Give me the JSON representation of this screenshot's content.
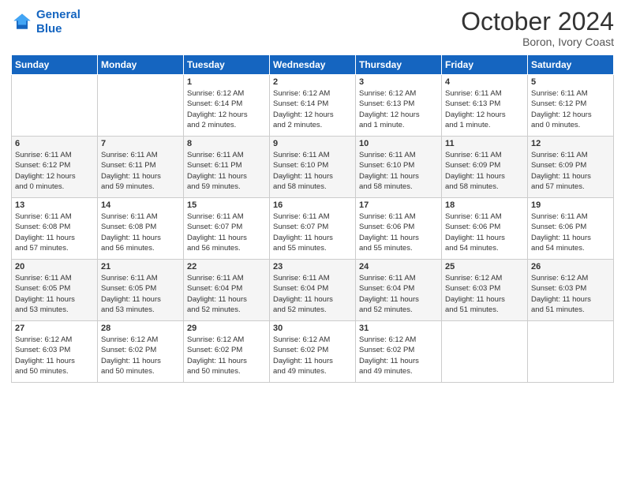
{
  "header": {
    "logo_line1": "General",
    "logo_line2": "Blue",
    "month_year": "October 2024",
    "location": "Boron, Ivory Coast"
  },
  "days_of_week": [
    "Sunday",
    "Monday",
    "Tuesday",
    "Wednesday",
    "Thursday",
    "Friday",
    "Saturday"
  ],
  "weeks": [
    [
      {
        "day": "",
        "info": ""
      },
      {
        "day": "",
        "info": ""
      },
      {
        "day": "1",
        "info": "Sunrise: 6:12 AM\nSunset: 6:14 PM\nDaylight: 12 hours\nand 2 minutes."
      },
      {
        "day": "2",
        "info": "Sunrise: 6:12 AM\nSunset: 6:14 PM\nDaylight: 12 hours\nand 2 minutes."
      },
      {
        "day": "3",
        "info": "Sunrise: 6:12 AM\nSunset: 6:13 PM\nDaylight: 12 hours\nand 1 minute."
      },
      {
        "day": "4",
        "info": "Sunrise: 6:11 AM\nSunset: 6:13 PM\nDaylight: 12 hours\nand 1 minute."
      },
      {
        "day": "5",
        "info": "Sunrise: 6:11 AM\nSunset: 6:12 PM\nDaylight: 12 hours\nand 0 minutes."
      }
    ],
    [
      {
        "day": "6",
        "info": "Sunrise: 6:11 AM\nSunset: 6:12 PM\nDaylight: 12 hours\nand 0 minutes."
      },
      {
        "day": "7",
        "info": "Sunrise: 6:11 AM\nSunset: 6:11 PM\nDaylight: 11 hours\nand 59 minutes."
      },
      {
        "day": "8",
        "info": "Sunrise: 6:11 AM\nSunset: 6:11 PM\nDaylight: 11 hours\nand 59 minutes."
      },
      {
        "day": "9",
        "info": "Sunrise: 6:11 AM\nSunset: 6:10 PM\nDaylight: 11 hours\nand 58 minutes."
      },
      {
        "day": "10",
        "info": "Sunrise: 6:11 AM\nSunset: 6:10 PM\nDaylight: 11 hours\nand 58 minutes."
      },
      {
        "day": "11",
        "info": "Sunrise: 6:11 AM\nSunset: 6:09 PM\nDaylight: 11 hours\nand 58 minutes."
      },
      {
        "day": "12",
        "info": "Sunrise: 6:11 AM\nSunset: 6:09 PM\nDaylight: 11 hours\nand 57 minutes."
      }
    ],
    [
      {
        "day": "13",
        "info": "Sunrise: 6:11 AM\nSunset: 6:08 PM\nDaylight: 11 hours\nand 57 minutes."
      },
      {
        "day": "14",
        "info": "Sunrise: 6:11 AM\nSunset: 6:08 PM\nDaylight: 11 hours\nand 56 minutes."
      },
      {
        "day": "15",
        "info": "Sunrise: 6:11 AM\nSunset: 6:07 PM\nDaylight: 11 hours\nand 56 minutes."
      },
      {
        "day": "16",
        "info": "Sunrise: 6:11 AM\nSunset: 6:07 PM\nDaylight: 11 hours\nand 55 minutes."
      },
      {
        "day": "17",
        "info": "Sunrise: 6:11 AM\nSunset: 6:06 PM\nDaylight: 11 hours\nand 55 minutes."
      },
      {
        "day": "18",
        "info": "Sunrise: 6:11 AM\nSunset: 6:06 PM\nDaylight: 11 hours\nand 54 minutes."
      },
      {
        "day": "19",
        "info": "Sunrise: 6:11 AM\nSunset: 6:06 PM\nDaylight: 11 hours\nand 54 minutes."
      }
    ],
    [
      {
        "day": "20",
        "info": "Sunrise: 6:11 AM\nSunset: 6:05 PM\nDaylight: 11 hours\nand 53 minutes."
      },
      {
        "day": "21",
        "info": "Sunrise: 6:11 AM\nSunset: 6:05 PM\nDaylight: 11 hours\nand 53 minutes."
      },
      {
        "day": "22",
        "info": "Sunrise: 6:11 AM\nSunset: 6:04 PM\nDaylight: 11 hours\nand 52 minutes."
      },
      {
        "day": "23",
        "info": "Sunrise: 6:11 AM\nSunset: 6:04 PM\nDaylight: 11 hours\nand 52 minutes."
      },
      {
        "day": "24",
        "info": "Sunrise: 6:11 AM\nSunset: 6:04 PM\nDaylight: 11 hours\nand 52 minutes."
      },
      {
        "day": "25",
        "info": "Sunrise: 6:12 AM\nSunset: 6:03 PM\nDaylight: 11 hours\nand 51 minutes."
      },
      {
        "day": "26",
        "info": "Sunrise: 6:12 AM\nSunset: 6:03 PM\nDaylight: 11 hours\nand 51 minutes."
      }
    ],
    [
      {
        "day": "27",
        "info": "Sunrise: 6:12 AM\nSunset: 6:03 PM\nDaylight: 11 hours\nand 50 minutes."
      },
      {
        "day": "28",
        "info": "Sunrise: 6:12 AM\nSunset: 6:02 PM\nDaylight: 11 hours\nand 50 minutes."
      },
      {
        "day": "29",
        "info": "Sunrise: 6:12 AM\nSunset: 6:02 PM\nDaylight: 11 hours\nand 50 minutes."
      },
      {
        "day": "30",
        "info": "Sunrise: 6:12 AM\nSunset: 6:02 PM\nDaylight: 11 hours\nand 49 minutes."
      },
      {
        "day": "31",
        "info": "Sunrise: 6:12 AM\nSunset: 6:02 PM\nDaylight: 11 hours\nand 49 minutes."
      },
      {
        "day": "",
        "info": ""
      },
      {
        "day": "",
        "info": ""
      }
    ]
  ]
}
